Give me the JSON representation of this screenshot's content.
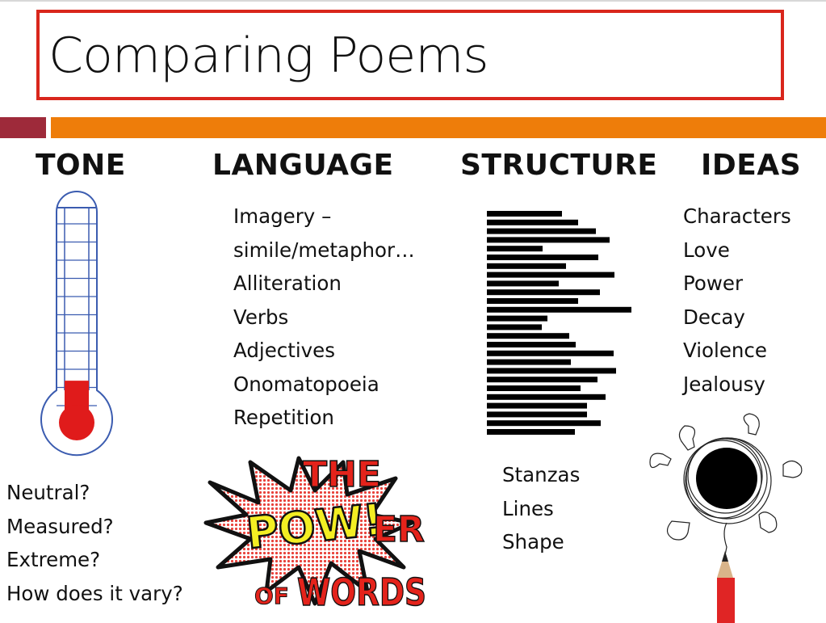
{
  "slide": {
    "title": "Comparing Poems",
    "colors": {
      "title_border": "#d9261c",
      "accent_maroon": "#9e2a3a",
      "accent_orange": "#ee7d0a",
      "thermometer_outline": "#3b5cb0",
      "thermometer_fill": "#e01b1b"
    },
    "columns": {
      "tone": {
        "heading": "TONE",
        "thermometer_level": 0.17,
        "questions": [
          "Neutral?",
          "Measured?",
          "Extreme?",
          "How does it vary?"
        ]
      },
      "language": {
        "heading": "LANGUAGE",
        "items": [
          "Imagery –",
          "simile/metaphor…",
          "Alliteration",
          "Verbs",
          "Adjectives",
          "Onomatopoeia",
          "Repetition"
        ],
        "image": {
          "line1": "THE",
          "pow": "POW!",
          "er": "ER",
          "of": "OF",
          "words": "WORDS"
        }
      },
      "structure": {
        "heading": "STRUCTURE",
        "line_lengths": [
          93,
          113,
          135,
          152,
          69,
          138,
          98,
          158,
          89,
          140,
          113,
          179,
          75,
          68,
          102,
          110,
          157,
          104,
          160,
          137,
          116,
          147,
          124,
          124,
          141,
          109
        ],
        "items": [
          "Stanzas",
          "Lines",
          "Shape"
        ]
      },
      "ideas": {
        "heading": "IDEAS",
        "items": [
          "Characters",
          "Love",
          "Power",
          "Decay",
          "Violence",
          "Jealousy"
        ]
      }
    }
  }
}
